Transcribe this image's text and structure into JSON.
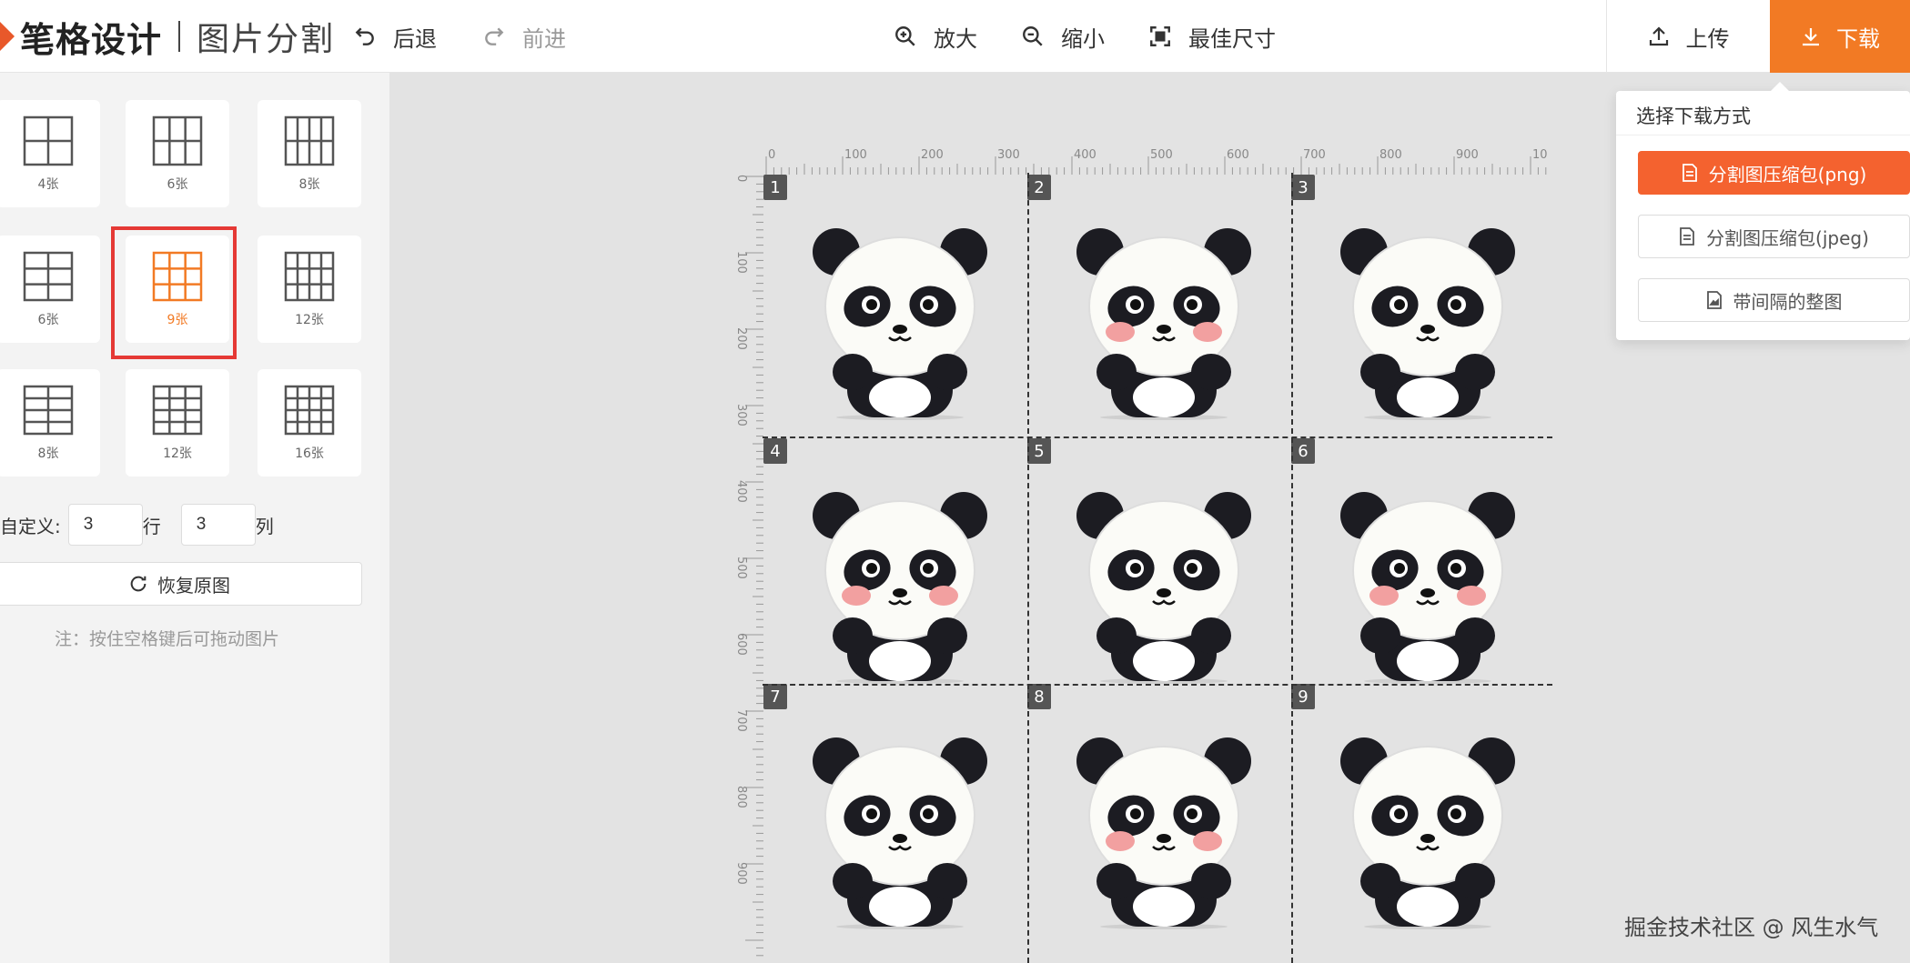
{
  "header": {
    "logo_text": "笔格设计",
    "page_title": "图片分割",
    "undo_label": "后退",
    "redo_label": "前进",
    "zoom_in_label": "放大",
    "zoom_out_label": "缩小",
    "fit_label": "最佳尺寸",
    "upload_label": "上传",
    "download_label": "下载"
  },
  "sidebar": {
    "grid_options": [
      {
        "label": "4张",
        "cols": 2,
        "rows": 2
      },
      {
        "label": "6张",
        "cols": 3,
        "rows": 2
      },
      {
        "label": "8张",
        "cols": 4,
        "rows": 2
      },
      {
        "label": "6张",
        "cols": 2,
        "rows": 3
      },
      {
        "label": "9张",
        "cols": 3,
        "rows": 3,
        "selected": true
      },
      {
        "label": "12张",
        "cols": 4,
        "rows": 3
      },
      {
        "label": "8张",
        "cols": 2,
        "rows": 4
      },
      {
        "label": "12张",
        "cols": 3,
        "rows": 4
      },
      {
        "label": "16张",
        "cols": 4,
        "rows": 4
      }
    ],
    "custom_label": "自定义:",
    "rows_value": "3",
    "rows_unit": "行",
    "cols_value": "3",
    "cols_unit": "列",
    "restore_label": "恢复原图",
    "note": "注：按住空格键后可拖动图片"
  },
  "canvas": {
    "ruler_h_labels": [
      "0",
      "100",
      "200",
      "300",
      "400",
      "500",
      "600",
      "700",
      "800",
      "900",
      "10"
    ],
    "ruler_v_labels": [
      "0",
      "100",
      "200",
      "300",
      "400",
      "500",
      "600",
      "700",
      "800",
      "900"
    ],
    "tiles": [
      "1",
      "2",
      "3",
      "4",
      "5",
      "6",
      "7",
      "8",
      "9"
    ]
  },
  "download_menu": {
    "title": "选择下载方式",
    "options": [
      "分割图压缩包(png)",
      "分割图压缩包(jpeg)",
      "带间隔的整图"
    ]
  },
  "watermark": "掘金技术社区 @ 风生水气",
  "colors": {
    "accent": "#f27a24",
    "primary_button": "#f4622f",
    "highlight": "#e53935"
  }
}
